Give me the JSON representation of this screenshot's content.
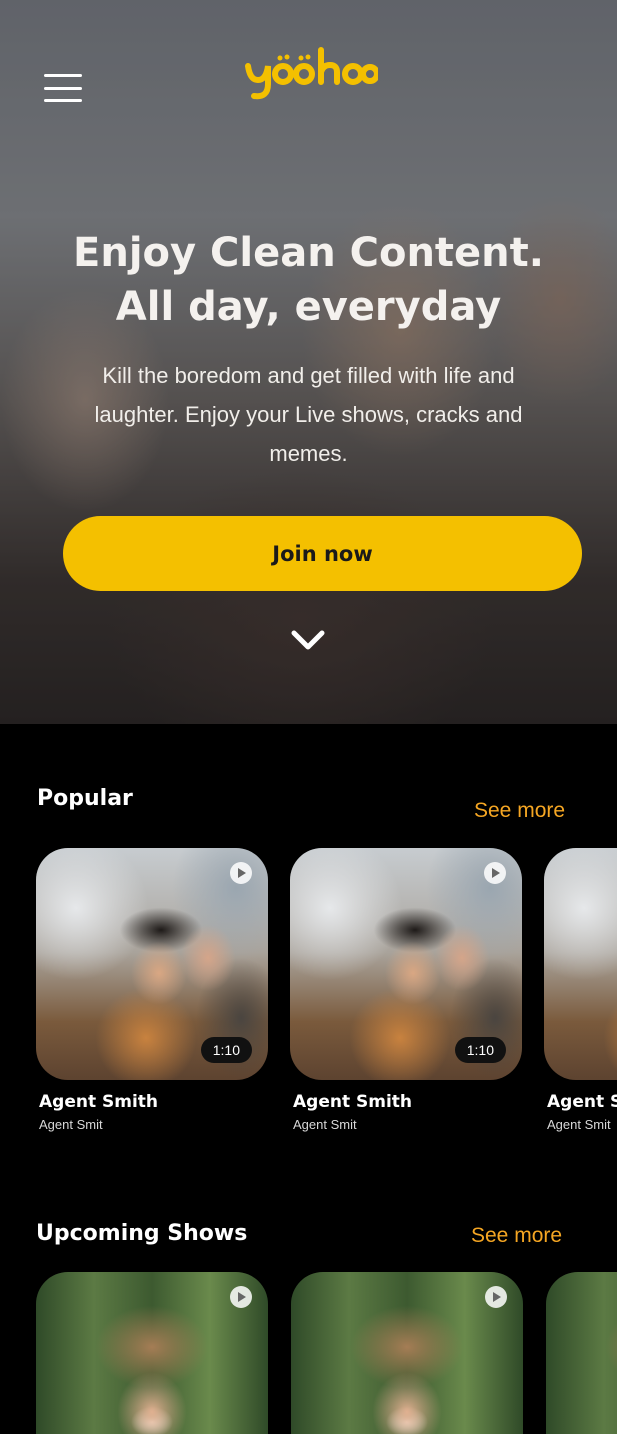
{
  "header": {
    "logo_text": "yoohoo",
    "menu_icon": "hamburger-menu-icon"
  },
  "hero": {
    "title_line1": "Enjoy Clean Content.",
    "title_line2": "All day, everyday",
    "subtitle": "Kill the boredom and get filled with life and laughter. Enjoy your Live shows, cracks and memes.",
    "cta_label": "Join now",
    "scroll_icon": "chevron-down-icon"
  },
  "popular": {
    "title": "Popular",
    "see_more": "See more",
    "items": [
      {
        "title": "Agent Smith",
        "subtitle": "Agent Smit",
        "duration": "1:10"
      },
      {
        "title": "Agent Smith",
        "subtitle": "Agent Smit",
        "duration": "1:10"
      },
      {
        "title": "Agent Smith",
        "subtitle": "Agent Smit",
        "duration": ""
      }
    ]
  },
  "upcoming": {
    "title": "Upcoming Shows",
    "see_more": "See more"
  },
  "colors": {
    "accent": "#f4c000",
    "link": "#f5a623",
    "background": "#000000"
  }
}
